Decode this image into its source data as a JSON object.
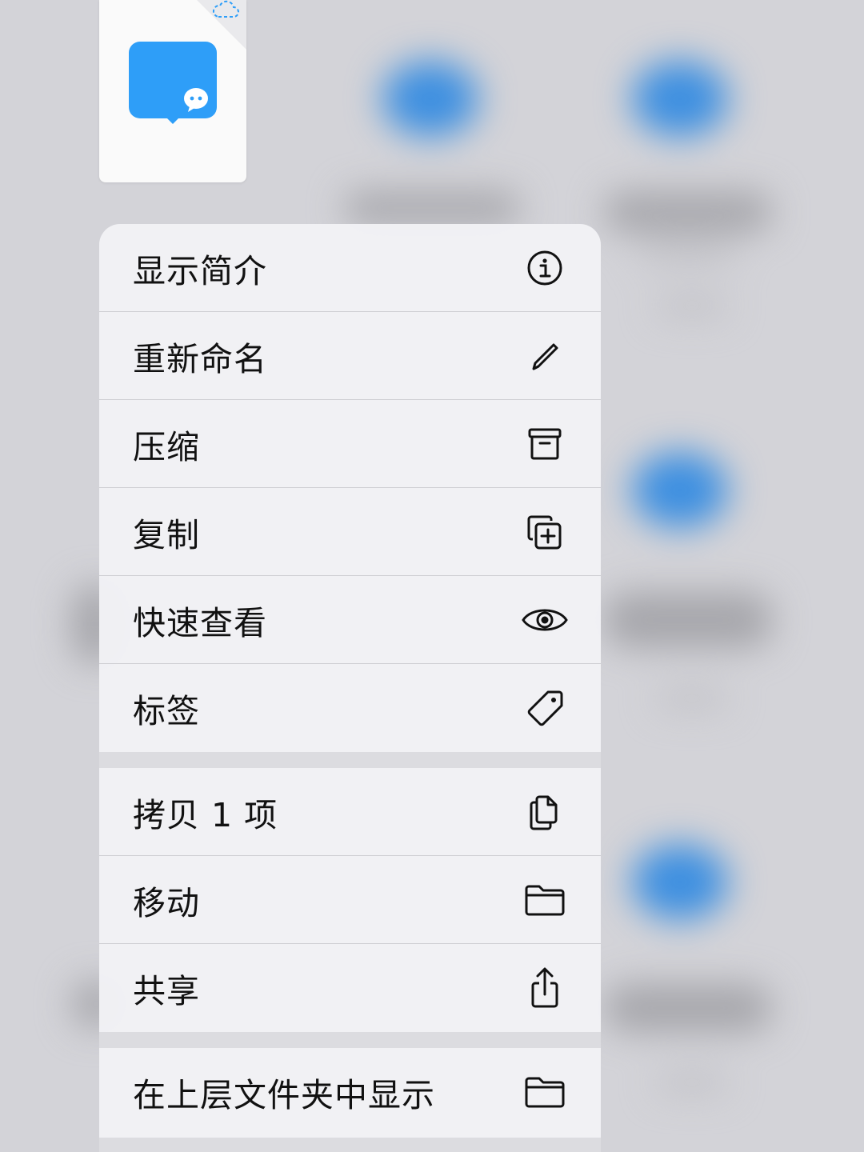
{
  "file": {
    "icon": "chat-bubble-app-icon",
    "cloud_status_icon": "cloud-download-icon",
    "accent_color": "#2e9ef8"
  },
  "menu": {
    "groups": [
      [
        {
          "label": "显示简介",
          "icon": "info-circle-icon"
        },
        {
          "label": "重新命名",
          "icon": "pencil-icon"
        },
        {
          "label": "压缩",
          "icon": "archive-box-icon"
        },
        {
          "label": "复制",
          "icon": "duplicate-plus-icon"
        },
        {
          "label": "快速查看",
          "icon": "eye-icon"
        },
        {
          "label": "标签",
          "icon": "tag-icon"
        }
      ],
      [
        {
          "label": "拷贝 1 项",
          "icon": "copy-documents-icon"
        },
        {
          "label": "移动",
          "icon": "folder-icon"
        },
        {
          "label": "共享",
          "icon": "share-icon"
        }
      ],
      [
        {
          "label": "在上层文件夹中显示",
          "icon": "folder-icon"
        }
      ]
    ]
  }
}
